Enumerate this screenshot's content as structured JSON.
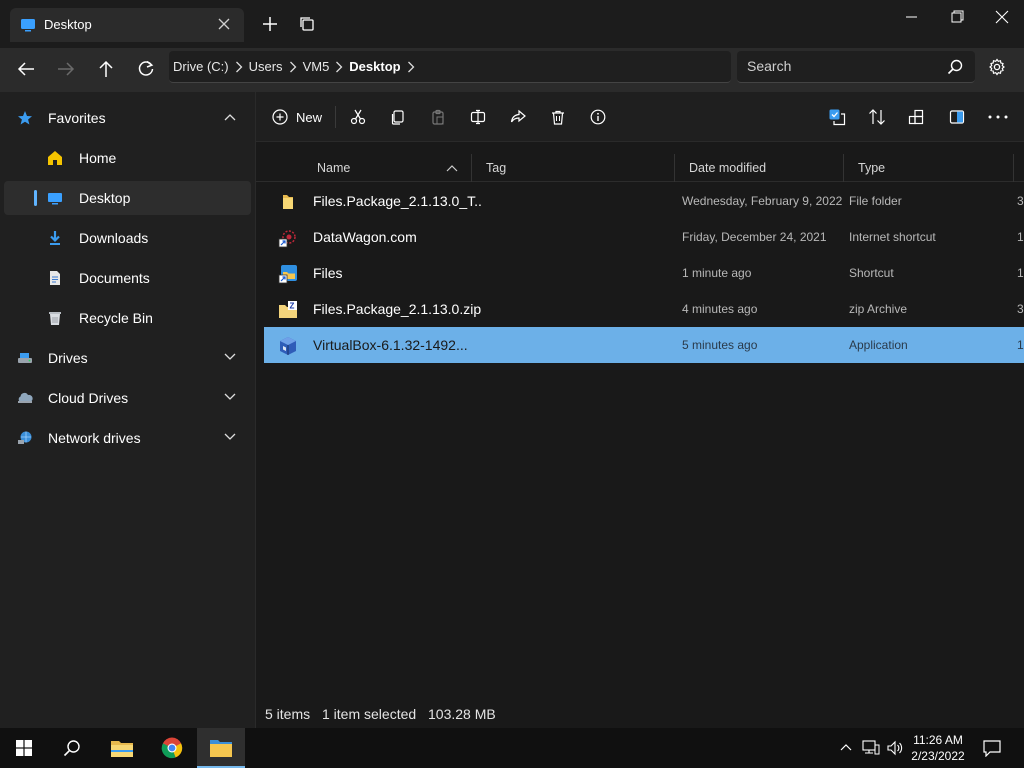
{
  "window": {
    "tab_label": "Desktop"
  },
  "nav": {
    "breadcrumb": [
      "Drive (C:)",
      "Users",
      "VM5",
      "Desktop"
    ],
    "search_placeholder": "Search"
  },
  "sidebar": {
    "items": [
      {
        "label": "Favorites",
        "icon": "star-icon",
        "level": 0,
        "expanded": true
      },
      {
        "label": "Home",
        "icon": "home-icon",
        "level": 1
      },
      {
        "label": "Desktop",
        "icon": "desktop-icon",
        "level": 1,
        "selected": true
      },
      {
        "label": "Downloads",
        "icon": "downloads-icon",
        "level": 1
      },
      {
        "label": "Documents",
        "icon": "documents-icon",
        "level": 1
      },
      {
        "label": "Recycle Bin",
        "icon": "recycle-bin-icon",
        "level": 1
      },
      {
        "label": "Drives",
        "icon": "drive-icon",
        "level": 0,
        "expanded": false
      },
      {
        "label": "Cloud Drives",
        "icon": "cloud-icon",
        "level": 0,
        "expanded": false
      },
      {
        "label": "Network drives",
        "icon": "network-icon",
        "level": 0,
        "expanded": false
      }
    ]
  },
  "toolbar": {
    "new_label": "New",
    "buttons": [
      "cut-icon",
      "copy-icon",
      "paste-icon",
      "rename-icon",
      "share-icon",
      "delete-icon",
      "properties-icon"
    ],
    "right_buttons": [
      "select-icon",
      "sort-icon",
      "layout-icon",
      "preview-pane-icon",
      "more-icon"
    ]
  },
  "columns": {
    "name": "Name",
    "tag": "Tag",
    "date_modified": "Date modified",
    "type": "Type"
  },
  "files": [
    {
      "name": "Files.Package_2.1.13.0_T...",
      "date": "Wednesday, February 9, 2022",
      "type": "File folder",
      "size": "3",
      "icon": "folder-icon"
    },
    {
      "name": "DataWagon.com",
      "date": "Friday, December 24, 2021",
      "type": "Internet shortcut",
      "size": "1",
      "icon": "internet-shortcut-icon"
    },
    {
      "name": "Files",
      "date": "1 minute ago",
      "type": "Shortcut",
      "size": "1",
      "icon": "app-shortcut-icon"
    },
    {
      "name": "Files.Package_2.1.13.0.zip",
      "date": "4 minutes ago",
      "type": "zip Archive",
      "size": "3",
      "icon": "zip-archive-icon"
    },
    {
      "name": "VirtualBox-6.1.32-1492...",
      "date": "5 minutes ago",
      "type": "Application",
      "size": "1",
      "icon": "virtualbox-icon",
      "selected": true
    }
  ],
  "status": {
    "items_count": "5 items",
    "selection": "1 item selected",
    "selection_size": "103.28 MB"
  },
  "taskbar": {
    "time": "11:26 AM",
    "date": "2/23/2022"
  },
  "colors": {
    "accent": "#60b4ff",
    "selected_row": "#6cb0e8",
    "background": "#202020"
  }
}
